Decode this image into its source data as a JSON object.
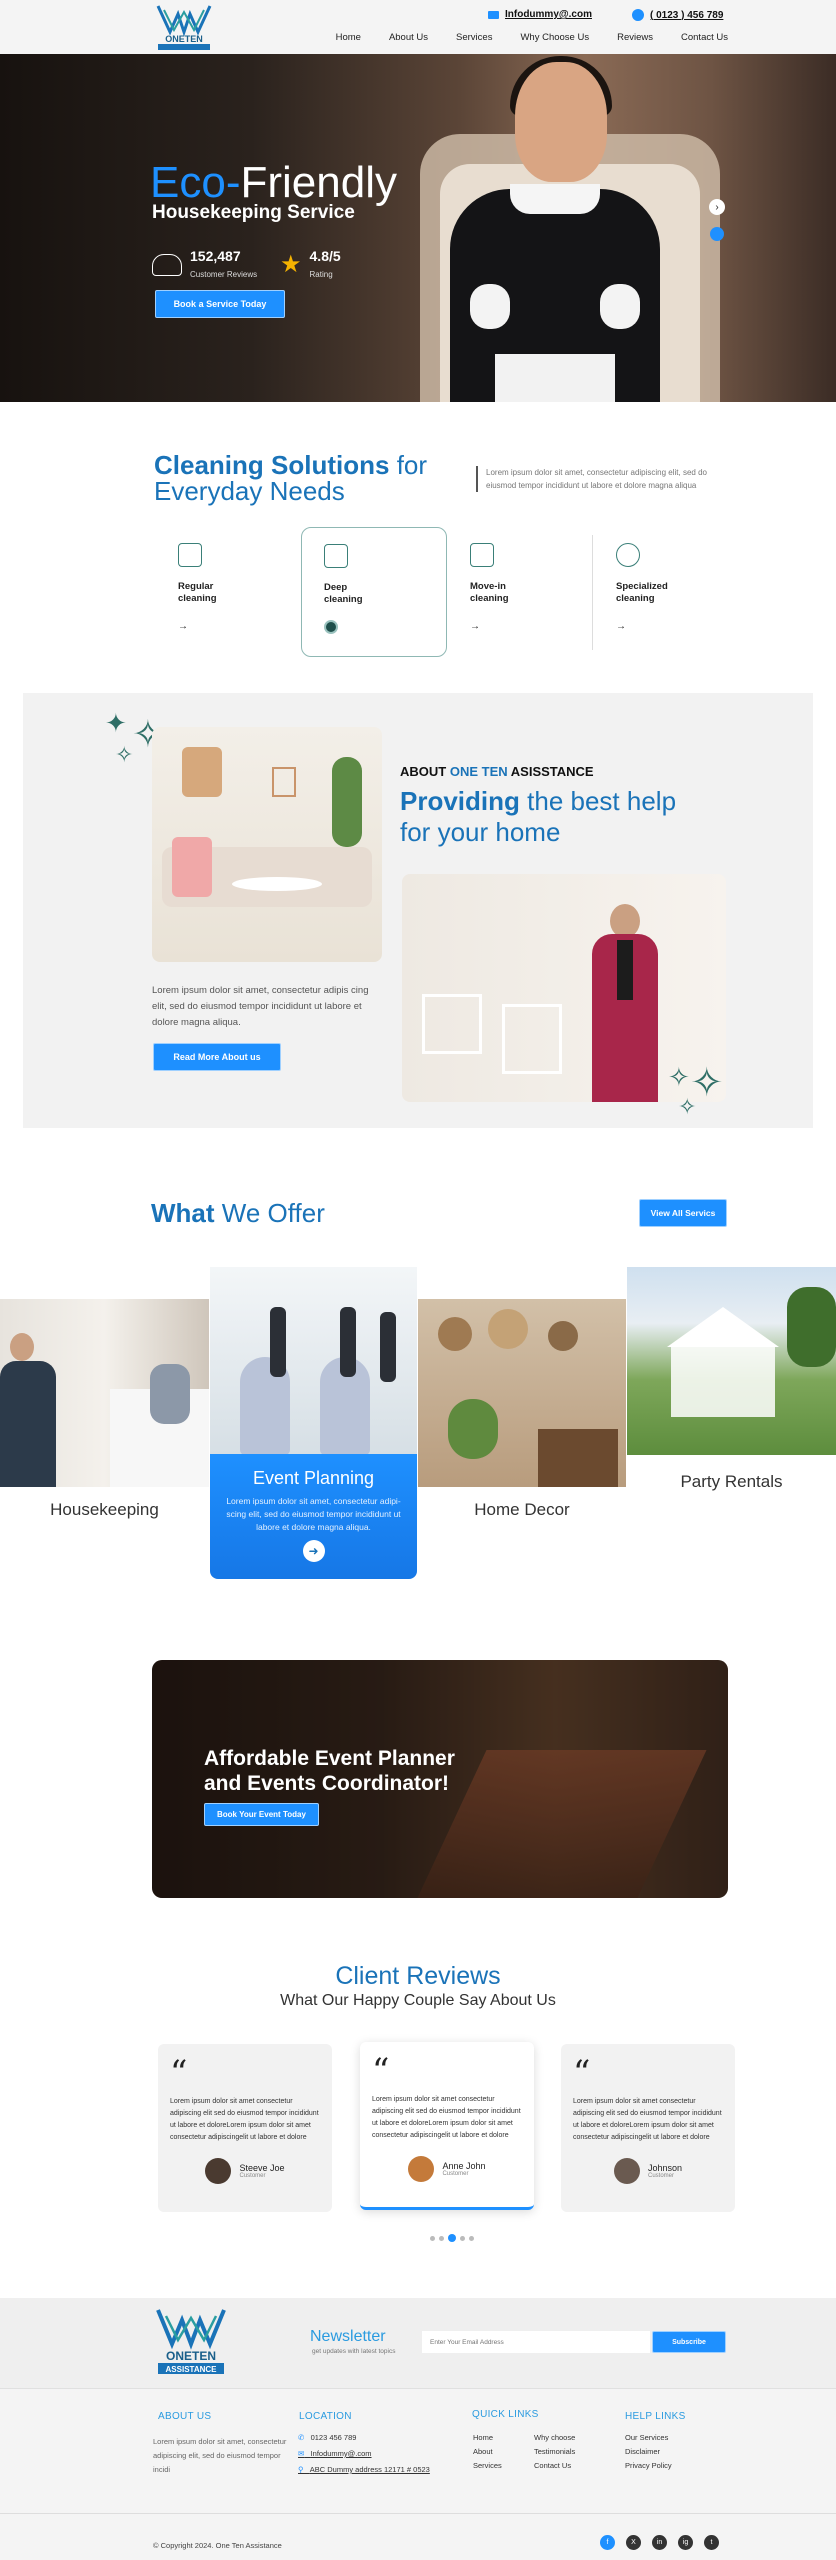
{
  "header": {
    "logo_line1": "ONETEN",
    "logo_line2": "ASSISTANCE",
    "email": "Infodummy@.com",
    "phone": "( 0123 ) 456 789",
    "nav": [
      "Home",
      "About Us",
      "Services",
      "Why Choose Us",
      "Reviews",
      "Contact Us"
    ]
  },
  "hero": {
    "title_accent": "Eco-",
    "title_rest": "Friendly",
    "subtitle": "Housekeeping Service",
    "reviews_count": "152,487",
    "reviews_label": "Customer Reviews",
    "rating": "4.8/5",
    "rating_label": "Rating",
    "cta": "Book a Service Today"
  },
  "solutions": {
    "title_bold": "Cleaning Solutions",
    "title_for": "for",
    "title_line2": "Everyday Needs",
    "desc": "Lorem ipsum dolor sit amet, consectetur adipiscing elit, sed do eiusmod tempor incididunt ut labore et dolore magna aliqua",
    "cards": [
      {
        "line1": "Regular",
        "line2": "cleaning"
      },
      {
        "line1": "Deep",
        "line2": "cleaning"
      },
      {
        "line1": "Move-in",
        "line2": "cleaning"
      },
      {
        "line1": "Specialized",
        "line2": "cleaning"
      }
    ]
  },
  "about": {
    "kicker_a": "ABOUT",
    "kicker_b": "ONE TEN",
    "kicker_c": "ASISSTANCE",
    "heading_bold": "Providing",
    "heading_rest": "the best help",
    "heading_line2": "for your home",
    "body": "Lorem ipsum dolor sit amet, consectetur adipis cing elit, sed do eiusmod tempor incididunt ut labore et dolore magna aliqua.",
    "cta": "Read More About us"
  },
  "offer": {
    "title_bold": "What",
    "title_rest": "We Offer",
    "view_all": "View All Servics",
    "tiles": [
      "Housekeeping",
      "Event Planning",
      "Home Decor",
      "Party Rentals"
    ],
    "event_desc": "Lorem ipsum dolor sit amet, consectetur adipi-scing elit, sed do eiusmod tempor incididunt ut labore et dolore magna aliqua."
  },
  "banner": {
    "line1": "Affordable Event Planner",
    "line2": "and Events Coordinator!",
    "cta": "Book Your Event Today"
  },
  "reviews": {
    "title": "Client Reviews",
    "subtitle": "What Our Happy Couple Say About Us",
    "quote_mark": "“",
    "text": "Lorem ipsum dolor sit amet consectetur adipiscing elit sed do eiusmod tempor incididunt ut labore et doloreLorem ipsum dolor sit amet consectetur adipiscingelit ut labore et dolore",
    "items": [
      {
        "name": "Steeve Joe",
        "role": "Customer"
      },
      {
        "name": "Anne John",
        "role": "Customer"
      },
      {
        "name": "Johnson",
        "role": "Customer"
      }
    ]
  },
  "newsletter": {
    "title": "Newsletter",
    "subtitle": "get updates with latest topics",
    "placeholder": "Enter Your Email Address",
    "button": "Subscribe"
  },
  "footer": {
    "about_h": "ABOUT US",
    "about_t": "Lorem ipsum dolor sit amet, consectetur adipiscing elit, sed do eiusmod tempor incidi",
    "location_h": "LOCATION",
    "phone": "0123 456 789",
    "email": "Infodummy@.com",
    "address": "ABC Dummy address 12171 # 0523",
    "quick_h": "QUICK LINKS",
    "quick_a": [
      "Home",
      "About",
      "Services"
    ],
    "quick_b": [
      "Why choose",
      "Testimonials",
      "Contact Us"
    ],
    "help_h": "HELP LINKS",
    "help": [
      "Our Services",
      "Disclaimer",
      "Privacy Policy"
    ],
    "copyright": "© Copyright 2024. One Ten Assistance",
    "social": [
      "f",
      "X",
      "in",
      "ig",
      "t"
    ]
  },
  "colors": {
    "accent": "#1e90ff",
    "brand": "#1a73b8",
    "teal": "#2e6e66"
  }
}
